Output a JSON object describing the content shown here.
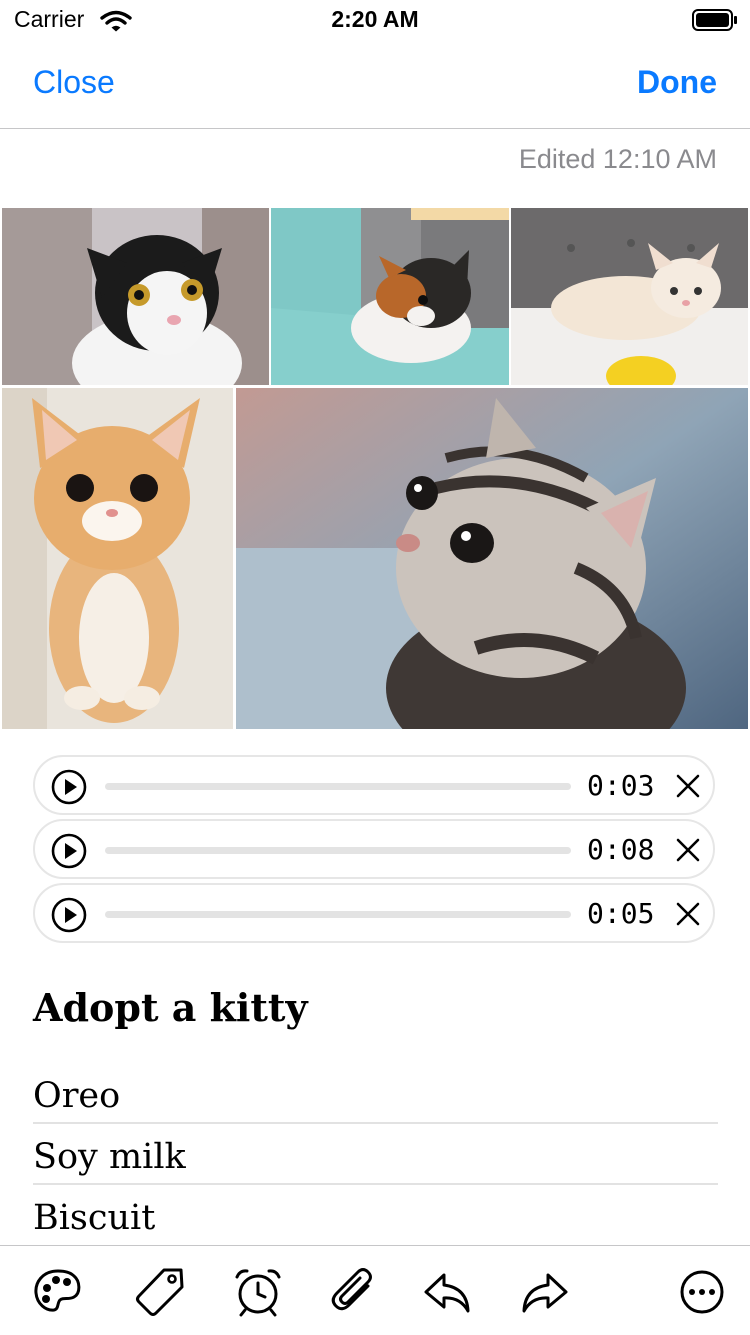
{
  "status_bar": {
    "carrier": "Carrier",
    "time": "2:20 AM"
  },
  "nav": {
    "close_label": "Close",
    "done_label": "Done"
  },
  "edited_label": "Edited 12:10 AM",
  "photos": [
    {
      "name": "black-white-kitten"
    },
    {
      "name": "calico-kitten-on-blanket"
    },
    {
      "name": "cream-kitten-on-bed"
    },
    {
      "name": "orange-kitten-standing"
    },
    {
      "name": "tabby-kitten-closeup"
    }
  ],
  "audio": [
    {
      "duration": "0:03"
    },
    {
      "duration": "0:08"
    },
    {
      "duration": "0:05"
    }
  ],
  "note": {
    "title": "Adopt a kitty",
    "items": [
      "Oreo",
      "Soy milk",
      "Biscuit"
    ]
  },
  "toolbar": {
    "icons": [
      "palette-icon",
      "tag-icon",
      "alarm-clock-icon",
      "paperclip-icon",
      "reply-icon",
      "forward-icon",
      "more-icon"
    ]
  },
  "colors": {
    "accent": "#0a7aff",
    "muted_text": "#8a8a8e",
    "divider": "#c6c6c8"
  }
}
